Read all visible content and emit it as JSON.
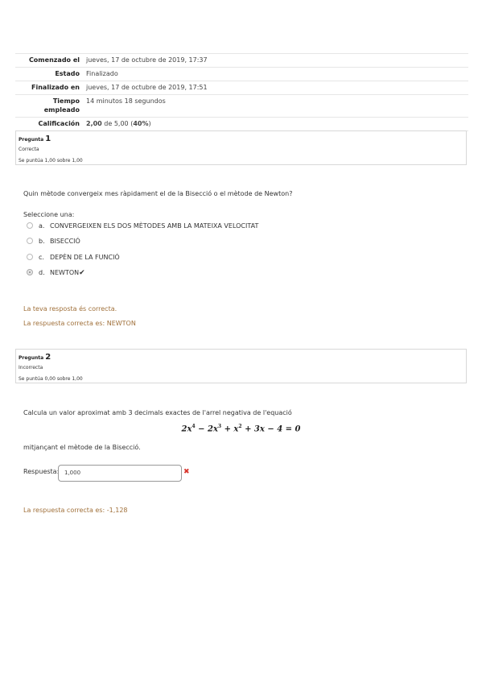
{
  "summary": {
    "started_label": "Comenzado el",
    "started_value": "jueves, 17 de octubre de 2019, 17:37",
    "state_label": "Estado",
    "state_value": "Finalizado",
    "finished_label": "Finalizado en",
    "finished_value": "jueves, 17 de octubre de 2019, 17:51",
    "time_label_1": "Tiempo",
    "time_label_2": "empleado",
    "time_value": "14 minutos 18 segundos",
    "grade_label": "Calificación",
    "grade_bold": "2,00",
    "grade_mid": " de 5,00 (",
    "grade_pct": "40%",
    "grade_end": ")"
  },
  "q1": {
    "label": "Pregunta",
    "number": "1",
    "state": "Correcta",
    "grade": "Se puntúa 1,00 sobre 1,00",
    "text": "Quin mètode convergeix mes ràpidament el de la Bisecció o el mètode de Newton?",
    "prompt": "Seleccione una:",
    "options": [
      {
        "letter": "a.",
        "label": "CONVERGEIXEN ELS DOS MÈTODES AMB LA MATEIXA VELOCITAT"
      },
      {
        "letter": "b.",
        "label": "BISECCIÓ"
      },
      {
        "letter": "c.",
        "label": "DEPÈN DE LA FUNCIÓ"
      },
      {
        "letter": "d.",
        "label": "NEWTON"
      }
    ],
    "check": "✔",
    "feedback": "La teva resposta és correcta.",
    "right_answer": "La respuesta correcta es: NEWTON"
  },
  "q2": {
    "label": "Pregunta",
    "number": "2",
    "state": "Incorrecta",
    "grade": "Se puntúa 0,00 sobre 1,00",
    "text": "Calcula un valor aproximat amb 3 decimals exactes de l'arrel negativa de l'equació",
    "formula": {
      "a": "2x",
      "e1": "4",
      "b": " − 2x",
      "e2": "3",
      "c": " + x",
      "e3": "2",
      "d": " + 3x − 4 = 0"
    },
    "text2": "mitjançant el mètode de la Bisecció.",
    "answer_label": "Respuesta:",
    "answer_value": "1,000",
    "wrong_mark": "✖",
    "right_answer": "La respuesta correcta es: -1,128"
  }
}
